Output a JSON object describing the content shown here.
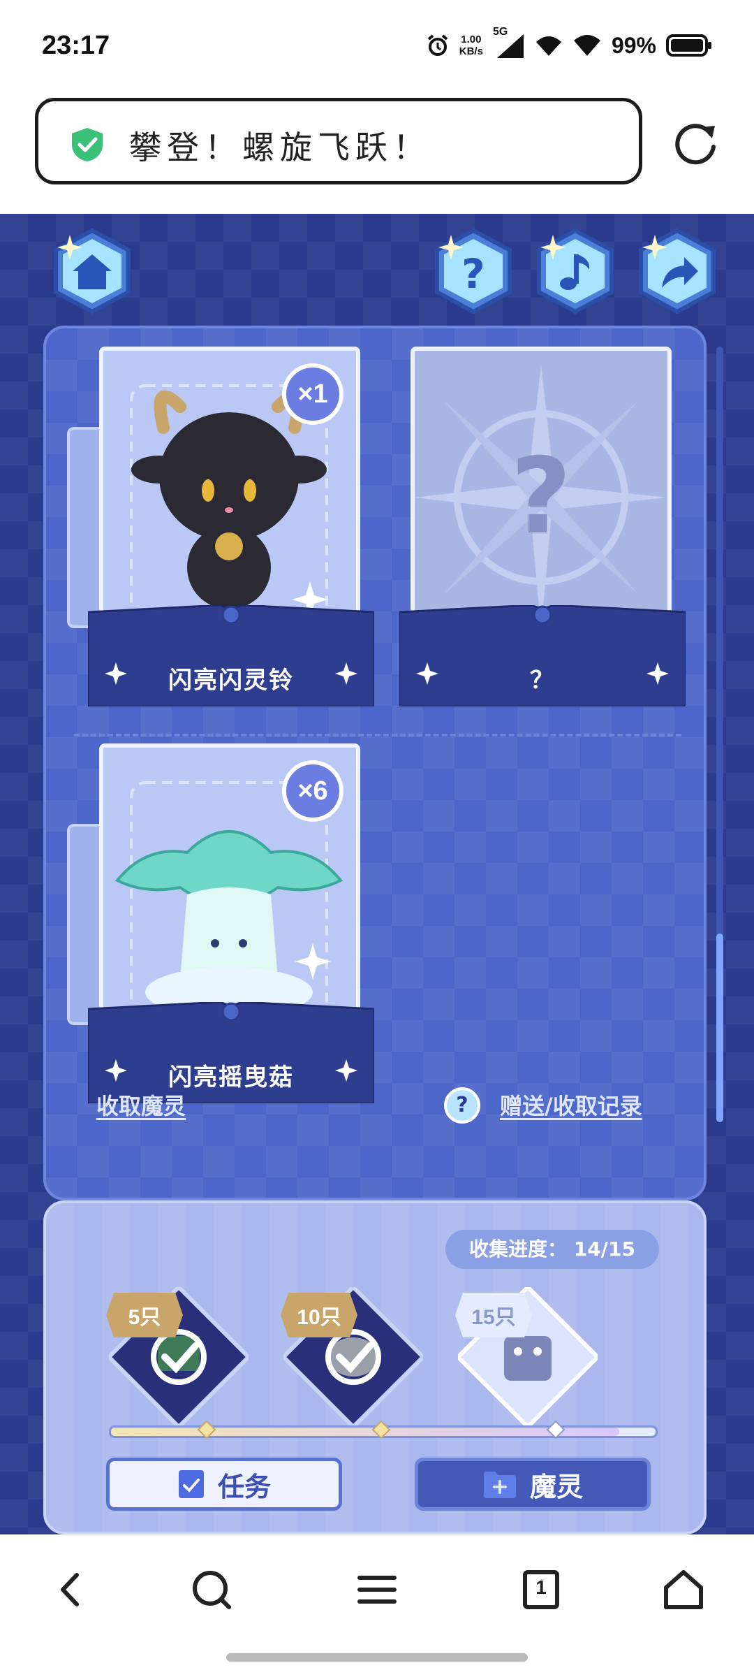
{
  "status_bar": {
    "time": "23:17",
    "net_speed_value": "1.00",
    "net_speed_unit": "KB/s",
    "network_type": "5G",
    "battery": "99%"
  },
  "browser": {
    "page_title": "攀登！螺旋飞跃！"
  },
  "game": {
    "cards": [
      {
        "name": "闪亮闪灵铃",
        "count": "×1",
        "locked": false
      },
      {
        "name": "？",
        "count": "",
        "locked": true
      },
      {
        "name": "闪亮摇曳菇",
        "count": "×6",
        "locked": false
      }
    ],
    "links": {
      "collect_spirit": "收取魔灵",
      "gift_records": "赠送/收取记录"
    },
    "progress": {
      "label": "收集进度：",
      "value": "14/15",
      "collected": 14,
      "total": 15,
      "milestones": [
        {
          "label": "5只",
          "threshold": 5,
          "claimed": true
        },
        {
          "label": "10只",
          "threshold": 10,
          "claimed": true
        },
        {
          "label": "15只",
          "threshold": 15,
          "claimed": false
        }
      ]
    },
    "buttons": {
      "task": "任务",
      "spirit": "魔灵"
    }
  },
  "navbar": {
    "tab_count": "1"
  },
  "colors": {
    "game_bg": "#2c3a8e",
    "panel_bg": "#4d66c9",
    "progress_bg": "#a9b9ee",
    "accent_gold": "#c8a56a"
  }
}
